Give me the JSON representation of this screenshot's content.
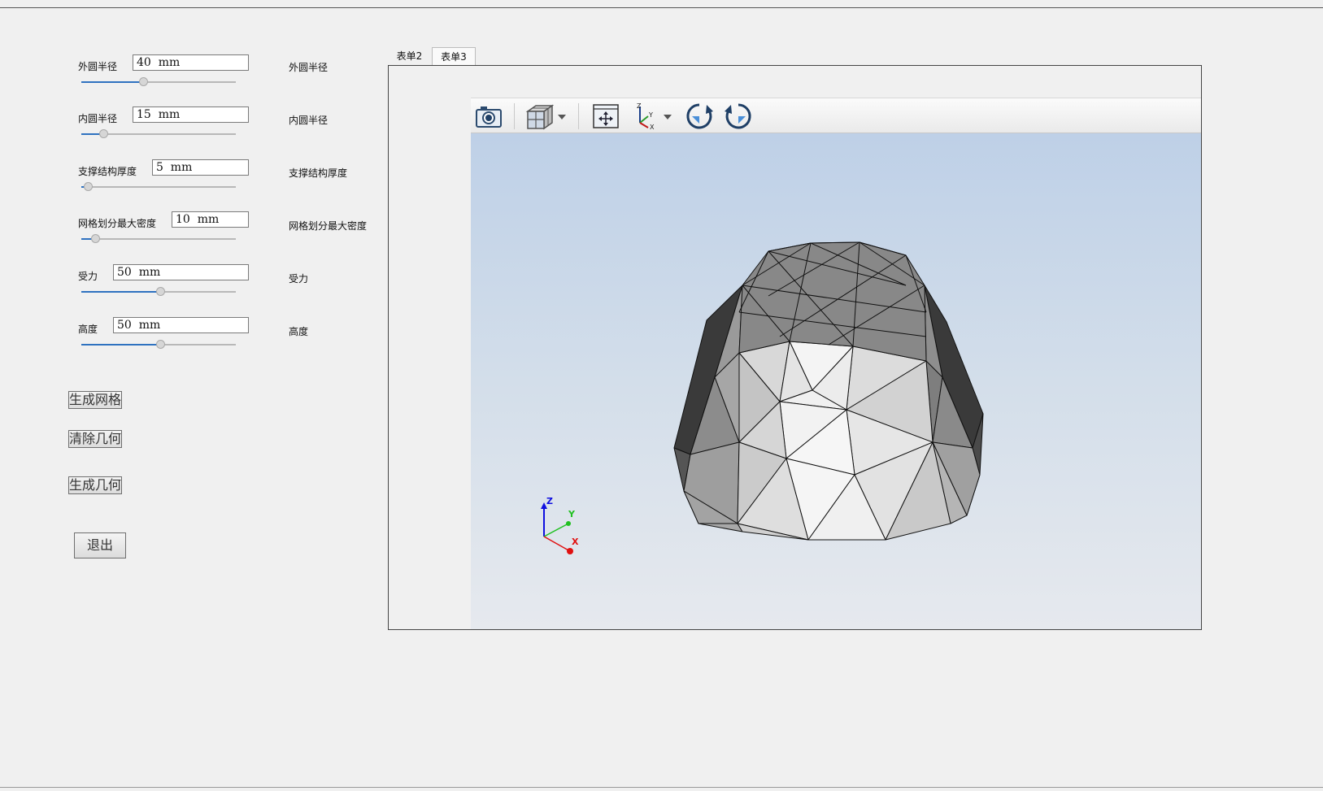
{
  "params": [
    {
      "label": "外圆半径",
      "value": "40  mm",
      "slider_fraction": 0.4
    },
    {
      "label": "内圆半径",
      "value": "15  mm",
      "slider_fraction": 0.14
    },
    {
      "label": "支撑结构厚度",
      "value": "5  mm",
      "slider_fraction": 0.04
    },
    {
      "label": "网格划分最大密度",
      "value": "10  mm",
      "slider_fraction": 0.09
    },
    {
      "label": "受力",
      "value": "50  mm",
      "slider_fraction": 0.51
    },
    {
      "label": "高度",
      "value": "50  mm",
      "slider_fraction": 0.51
    }
  ],
  "side_labels": [
    "外圆半径",
    "内圆半径",
    "支撑结构厚度",
    "网格划分最大密度",
    "受力",
    "高度"
  ],
  "buttons": {
    "generate_mesh": "生成网格",
    "clear_geometry": "清除几何",
    "generate_geometry": "生成几何",
    "exit": "退出"
  },
  "tabs": [
    {
      "label": "表单2",
      "active": false
    },
    {
      "label": "表单3",
      "active": true
    }
  ],
  "toolbar": {
    "icons": [
      "camera-icon",
      "view-cube-icon",
      "dropdown-arrow-icon",
      "fit-view-icon",
      "axes-orientation-icon",
      "dropdown-arrow-icon",
      "rotate-clockwise-icon",
      "rotate-counterclockwise-icon"
    ]
  },
  "axis_triad": {
    "z": "Z",
    "y": "Y",
    "x": "X"
  },
  "colors": {
    "window_bg": "#f0f0f0",
    "slider_fill": "#2f72c0",
    "canvas_top": "#bed0e7",
    "canvas_bottom": "#e6e9ee",
    "axis_x": "#e01010",
    "axis_y": "#20c020",
    "axis_z": "#1010e0"
  }
}
